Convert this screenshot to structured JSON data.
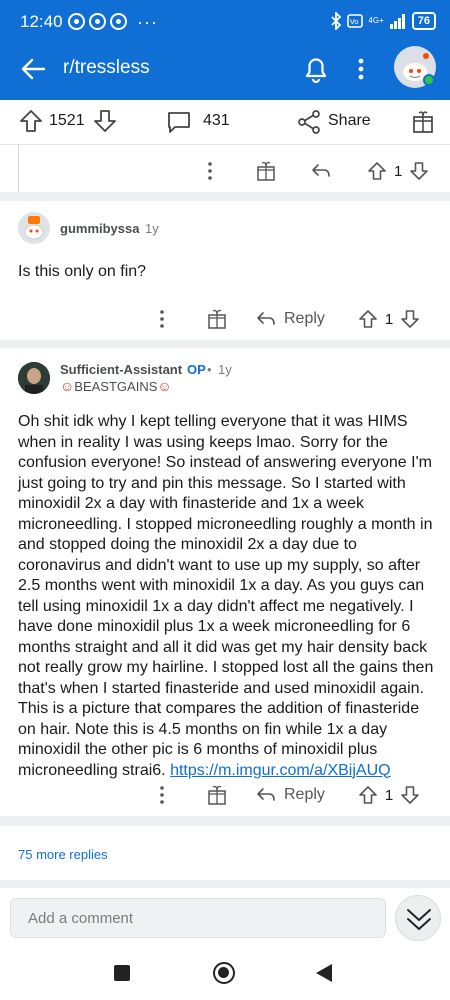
{
  "status_bar": {
    "time": "12:40",
    "battery": "76",
    "network": "4G+",
    "icons": [
      "chrome-icon",
      "chrome-icon",
      "chrome-icon",
      "more-icon",
      "bluetooth-icon",
      "volte-icon",
      "signal-icon",
      "battery-icon"
    ]
  },
  "header": {
    "title": "r/tressless",
    "icons": [
      "back-arrow-icon",
      "bell-icon",
      "kebab-icon",
      "reddit-avatar-icon"
    ]
  },
  "post_actions": {
    "upvotes": "1521",
    "comments": "431",
    "share_label": "Share"
  },
  "comments": [
    {
      "username": "gummibyssa",
      "age": "1y",
      "text": "Is this only on fin?",
      "reply_label": "Reply",
      "votes": "1"
    },
    {
      "username": "Sufficient-Assistant",
      "op_label": "OP",
      "age": "1y",
      "flair": "BEASTGAINS",
      "text": "Oh shit idk why I kept telling everyone that it was HIMS when in reality I was using keeps lmao. Sorry for the confusion everyone! So instead of answering everyone I'm just going to try and pin this message. So I started with minoxidil 2x a day with finasteride and 1x a week microneedling. I stopped microneedling roughly a month in and stopped doing the minoxidil 2x a day due to coronavirus and didn't want to use up my supply, so after 2.5 months went with minoxidil 1x a day. As you guys can tell using minoxidil 1x a day didn't affect me negatively. I have done minoxidil plus 1x a week microneedling for 6 months straight and all it did was get my hair density back not really grow my hairline. I stopped lost all the gains then that's when I started finasteride and used minoxidil again. This is a picture that compares the addition of finasteride on hair. Note this is 4.5 months on fin while 1x a day minoxidil the other pic is 6 months of minoxidil plus microneedling strai6. ",
      "link": "https://m.imgur.com/a/XBijAUQ",
      "reply_label": "Reply",
      "votes": "1"
    }
  ],
  "previous_comment_votes": "1",
  "more_replies": "75 more replies",
  "comment_input": {
    "placeholder": "Add a comment"
  },
  "colors": {
    "header_blue": "#0f6fd4",
    "link_blue": "#0f6fd4",
    "background": "#eeeff1"
  }
}
